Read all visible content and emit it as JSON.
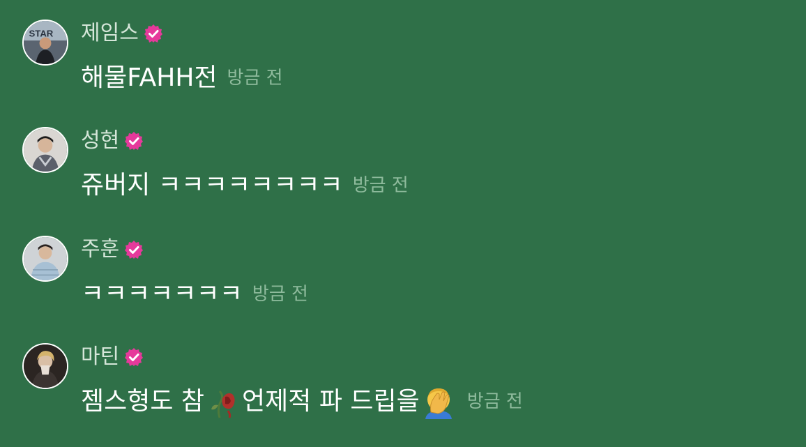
{
  "colors": {
    "background": "#2f7048",
    "name": "#d5e6d9",
    "message": "#ffffff",
    "timestamp": "#8fbb9d",
    "verified_badge": "#e6399b"
  },
  "messages": [
    {
      "author": "제임스",
      "verified_icon": "verified-badge-icon",
      "text": "해물FAHH전",
      "time": "방금 전"
    },
    {
      "author": "성현",
      "verified_icon": "verified-badge-icon",
      "text": "쥬버지 ㅋㅋㅋㅋㅋㅋㅋㅋ",
      "time": "방금 전"
    },
    {
      "author": "주훈",
      "verified_icon": "verified-badge-icon",
      "text": "ㅋㅋㅋㅋㅋㅋㅋ",
      "time": "방금 전"
    },
    {
      "author": "마틴",
      "verified_icon": "verified-badge-icon",
      "text_part1": "젬스형도 참",
      "emoji1": "wilted-flower-icon",
      "text_part2": " 언제적 파 드립을",
      "emoji2": "face-palm-icon",
      "time": "방금 전"
    }
  ]
}
